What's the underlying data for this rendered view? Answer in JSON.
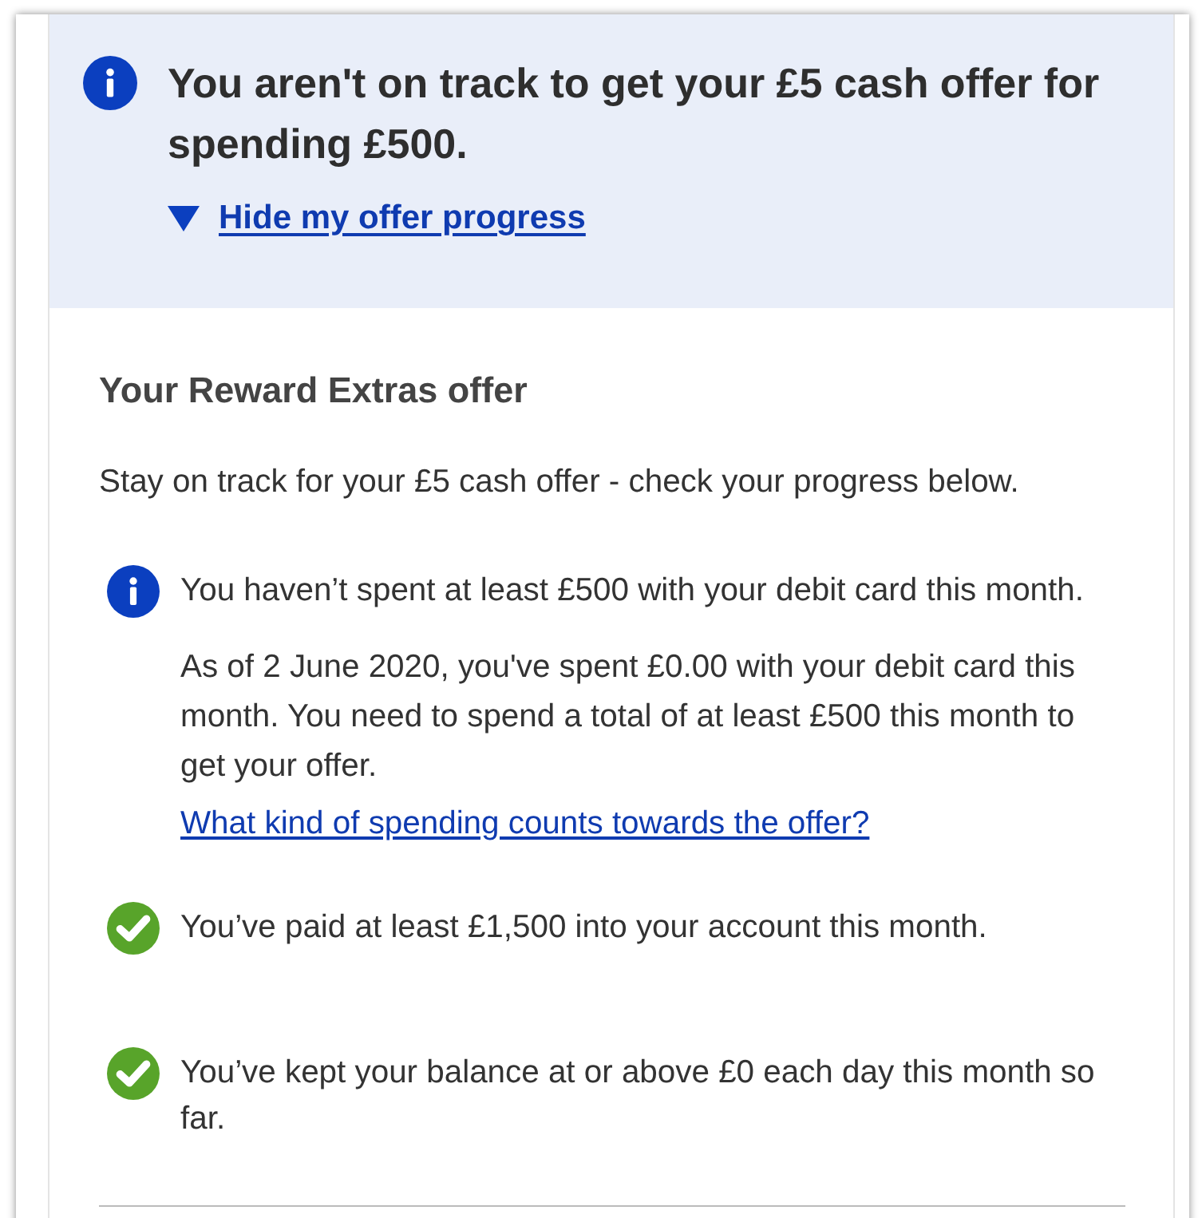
{
  "banner": {
    "title": "You aren't on track to get your £5 cash offer for spending £500.",
    "toggle": {
      "label": "Hide my offer progress",
      "expanded": true
    }
  },
  "offer": {
    "heading": "Your Reward Extras offer",
    "intro": "Stay on track for your £5 cash offer - check your progress below.",
    "conditions": [
      {
        "met": false,
        "text": "You haven’t spent at least £500 with your debit card this month.",
        "details": "As of 2 June 2020, you've spent £0.00 with your debit card this month. You need to spend a total of at least £500 this month to get your offer.",
        "link": "What kind of spending counts towards the offer?"
      },
      {
        "met": true,
        "text": "You’ve paid at least £1,500 into your account this month."
      },
      {
        "met": true,
        "text": "You’ve kept your balance at or above £0 each day this month so far."
      }
    ]
  }
}
